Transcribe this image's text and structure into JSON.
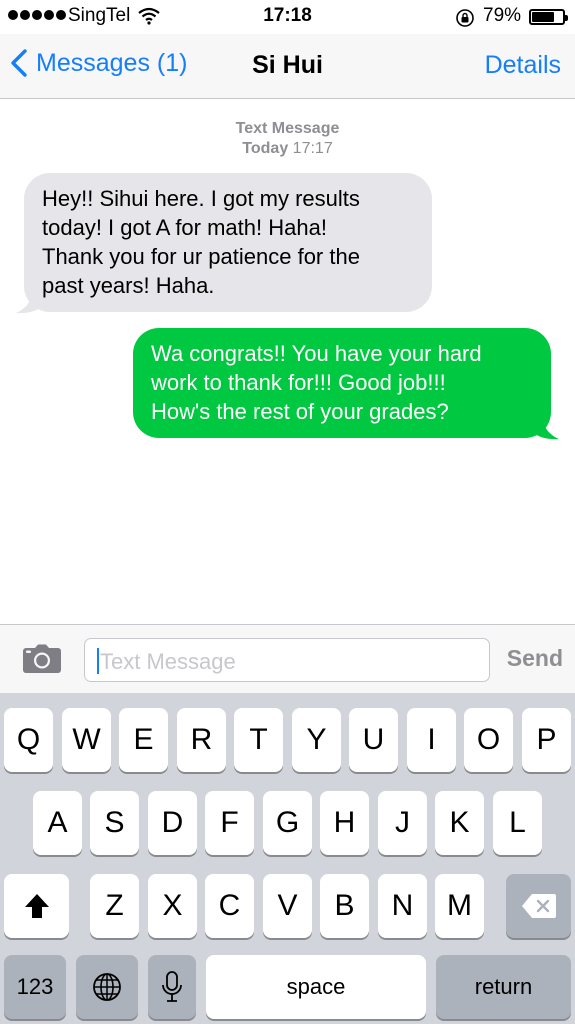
{
  "status_bar": {
    "carrier": "SingTel",
    "time": "17:18",
    "battery_percent": "79%",
    "battery_level": 0.79
  },
  "nav": {
    "back_label": "Messages (1)",
    "title": "Si Hui",
    "details_label": "Details"
  },
  "conversation": {
    "meta_type": "Text Message",
    "meta_day": "Today",
    "meta_time": "17:17",
    "messages": [
      {
        "direction": "incoming",
        "lines": [
          "Hey!! Sihui here. I got my results",
          "today! I got A for math! Haha!",
          "Thank you for ur patience for the",
          "past years! Haha."
        ]
      },
      {
        "direction": "outgoing",
        "lines": [
          "Wa congrats!! You have your hard",
          "work to thank for!!! Good job!!!",
          "How's the rest of your grades?"
        ]
      }
    ]
  },
  "input": {
    "placeholder": "Text Message",
    "send_label": "Send"
  },
  "keyboard": {
    "row1": [
      "Q",
      "W",
      "E",
      "R",
      "T",
      "Y",
      "U",
      "I",
      "O",
      "P"
    ],
    "row2": [
      "A",
      "S",
      "D",
      "F",
      "G",
      "H",
      "J",
      "K",
      "L"
    ],
    "row3": [
      "Z",
      "X",
      "C",
      "V",
      "B",
      "N",
      "M"
    ],
    "numbers_label": "123",
    "space_label": "space",
    "return_label": "return"
  },
  "colors": {
    "ios_blue": "#157efb",
    "incoming_bubble": "#e5e5ea",
    "outgoing_bubble": "#00c840",
    "keyboard_bg": "#d1d5db"
  }
}
